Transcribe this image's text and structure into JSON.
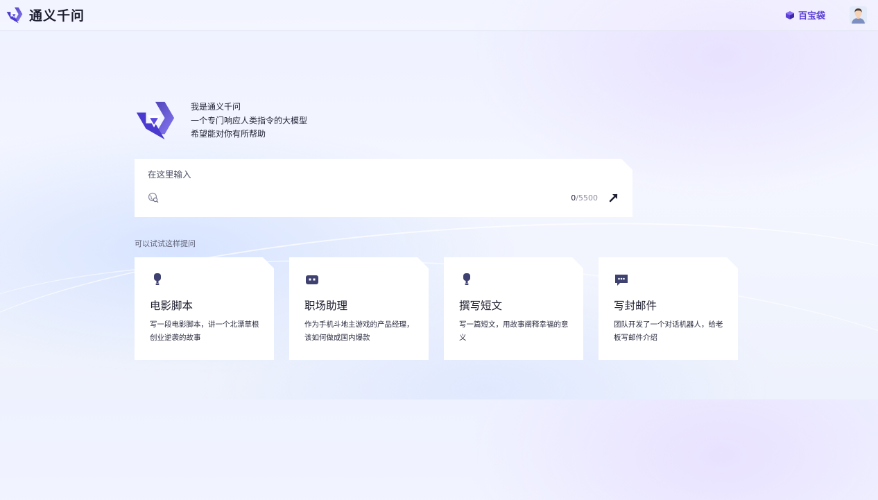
{
  "header": {
    "brand_name": "通义千问",
    "treasure_label": "百宝袋"
  },
  "intro": {
    "lines": [
      "我是通义千问",
      "一个专门响应人类指令的大模型",
      "希望能对你有所帮助"
    ]
  },
  "input": {
    "placeholder": "在这里输入",
    "count_current": "0",
    "count_max": "/5500"
  },
  "suggestions": {
    "title": "可以试试这样提问",
    "cards": [
      {
        "title": "电影脚本",
        "desc": "写一段电影脚本，讲一个北漂草根创业逆袭的故事",
        "icon": "bulb-icon"
      },
      {
        "title": "职场助理",
        "desc": "作为手机斗地主游戏的产品经理，该如何做成国内爆款",
        "icon": "robot-icon"
      },
      {
        "title": "撰写短文",
        "desc": "写一篇短文，用故事阐释幸福的意义",
        "icon": "bulb-icon"
      },
      {
        "title": "写封邮件",
        "desc": "团队开发了一个对话机器人，给老板写邮件介绍",
        "icon": "chat-icon"
      }
    ]
  },
  "colors": {
    "accent": "#5b3fd6",
    "icon_dark": "#3f4170",
    "text": "#1f2033"
  }
}
